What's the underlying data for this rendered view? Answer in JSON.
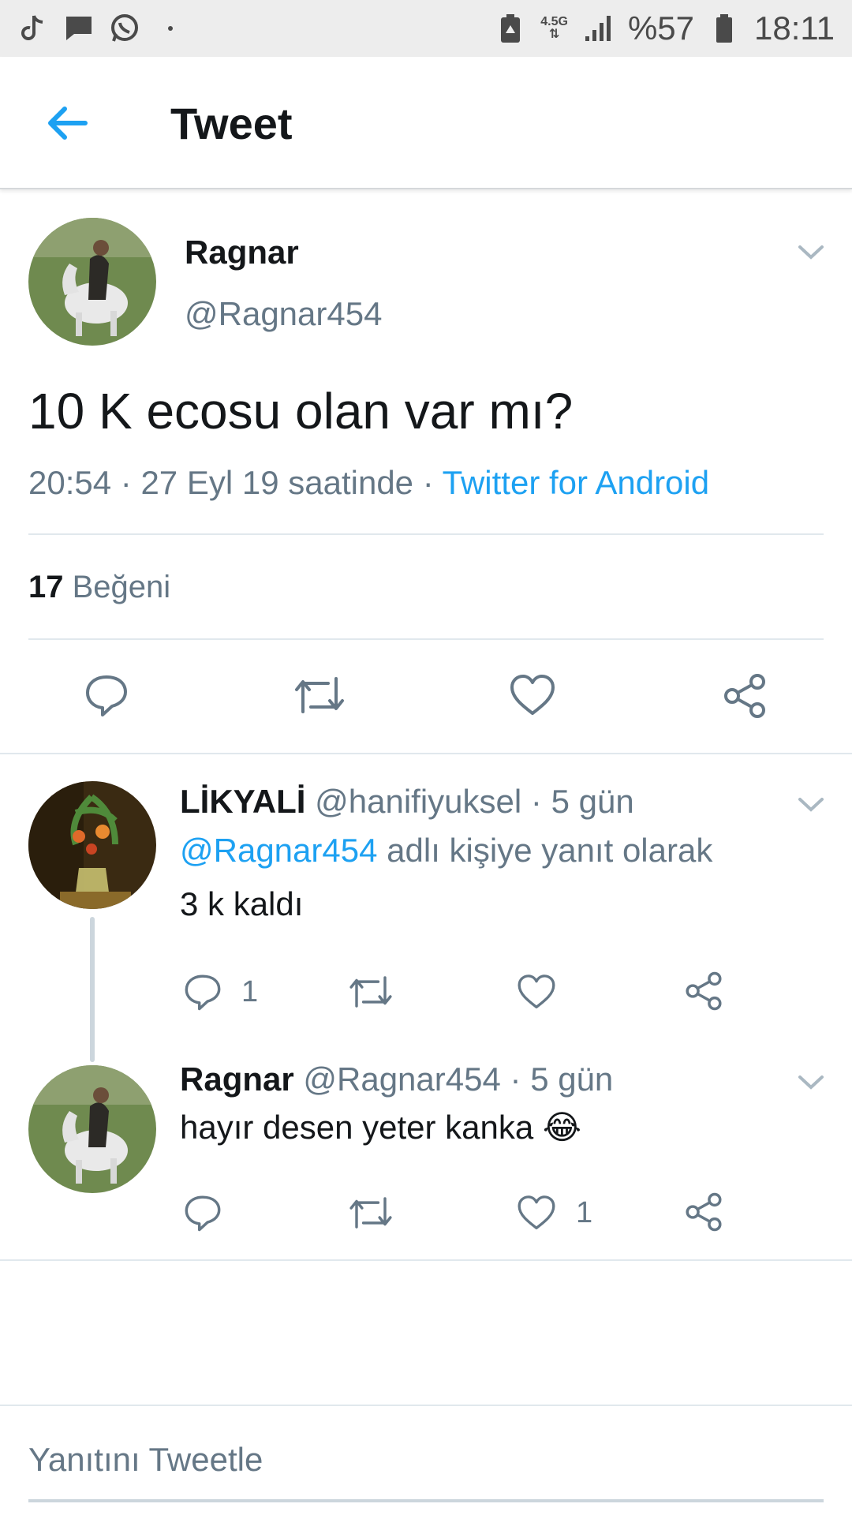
{
  "status_bar": {
    "network": "4.5G",
    "battery_percent": "%57",
    "time": "18:11"
  },
  "header": {
    "title": "Tweet"
  },
  "main_tweet": {
    "name": "Ragnar",
    "handle": "@Ragnar454",
    "text": "10 K ecosu olan var mı?",
    "time": "20:54",
    "date_text": "27 Eyl 19 saatinde",
    "separator": "·",
    "source": "Twitter for Android",
    "like_count": "17",
    "like_label": "Beğeni"
  },
  "replies": [
    {
      "name": "LİKYALİ",
      "handle": "@hanifiyuksel",
      "age": "5 gün",
      "reply_to_handle": "@Ragnar454",
      "reply_to_text": "adlı kişiye yanıt olarak",
      "text": "3 k kaldı",
      "reply_count": "1",
      "like_count": ""
    },
    {
      "name": "Ragnar",
      "handle": "@Ragnar454",
      "age": "5 gün",
      "text": "hayır desen yeter kanka 😂",
      "reply_count": "",
      "like_count": "1"
    }
  ],
  "composer": {
    "placeholder": "Yanıtını Tweetle"
  },
  "colors": {
    "accent": "#1da1f2",
    "muted": "#657786",
    "text": "#14171a"
  }
}
